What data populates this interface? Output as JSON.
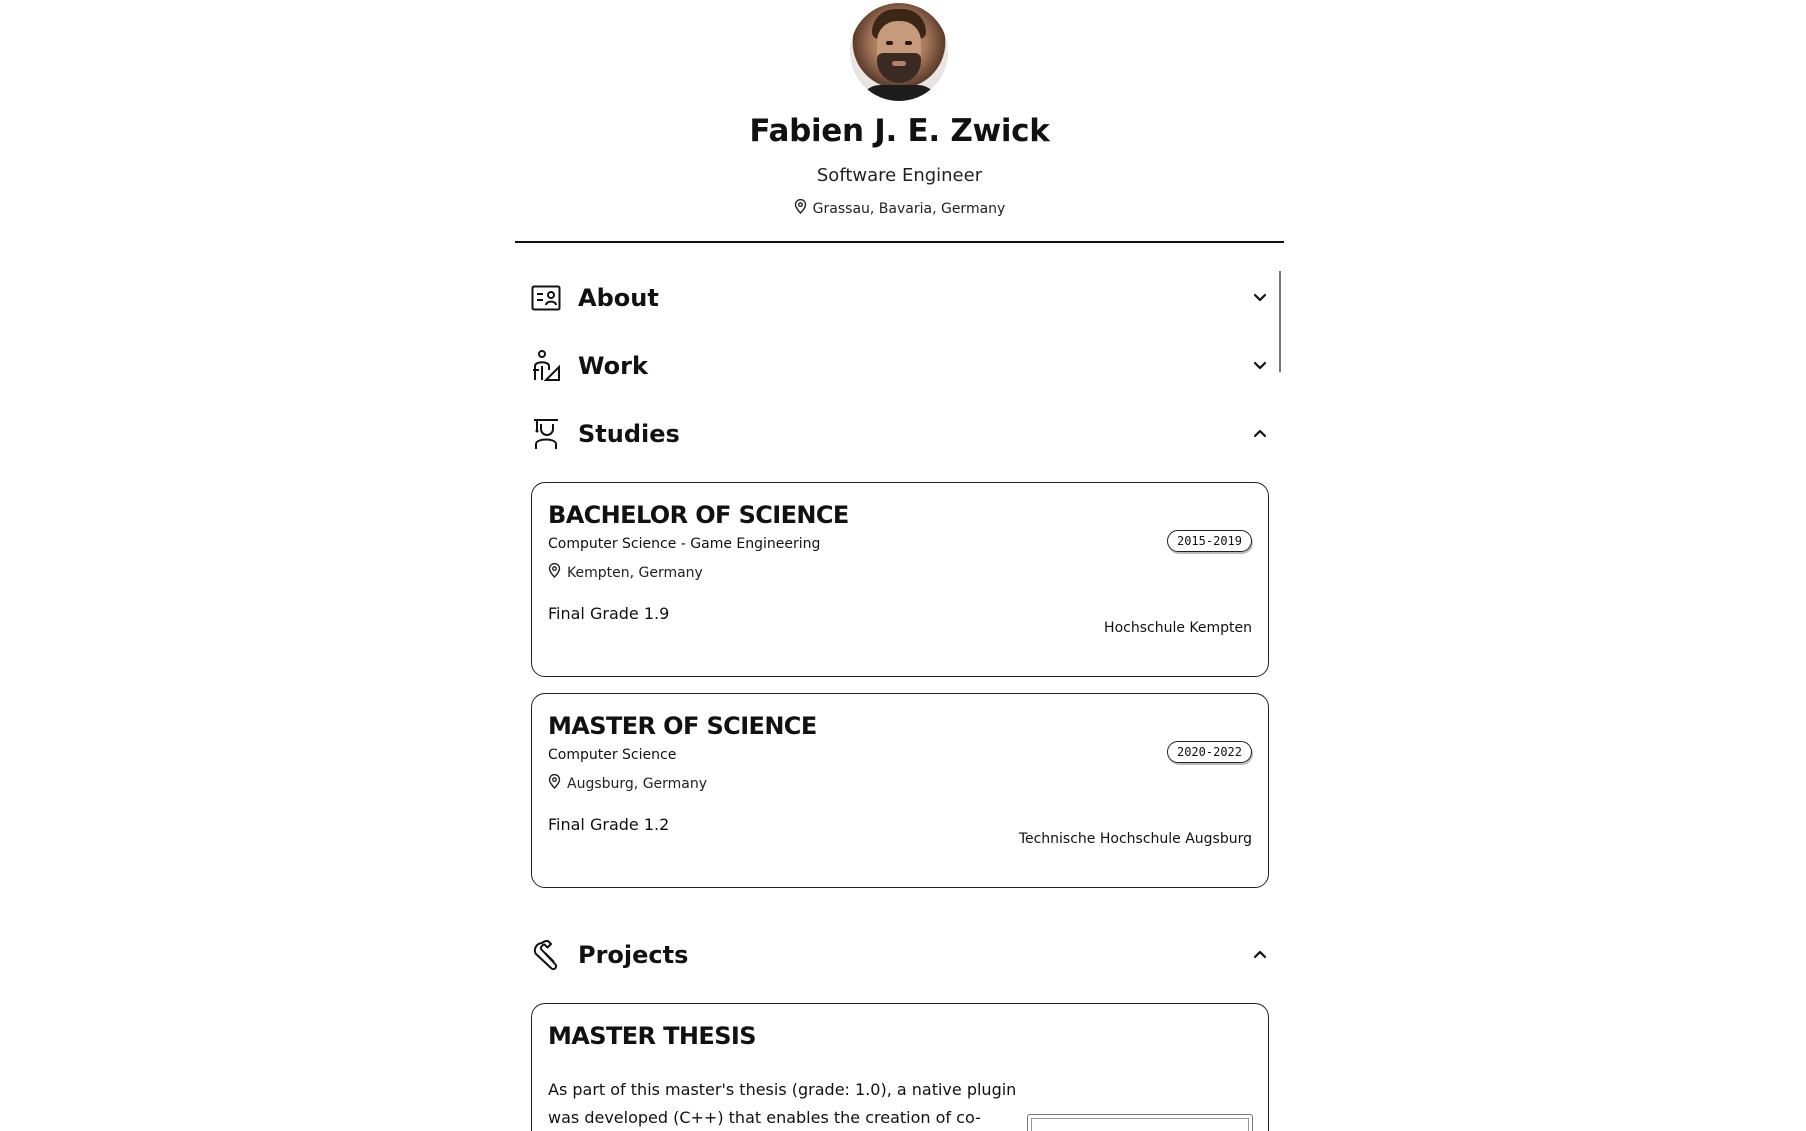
{
  "profile": {
    "name": "Fabien J. E. Zwick",
    "role": "Software Engineer",
    "location": "Grassau, Bavaria, Germany"
  },
  "sections": {
    "about": {
      "label": "About",
      "icon": "id-card-icon",
      "expanded": false
    },
    "work": {
      "label": "Work",
      "icon": "worker-icon",
      "expanded": false
    },
    "studies": {
      "label": "Studies",
      "icon": "graduate-icon",
      "expanded": true
    },
    "projects": {
      "label": "Projects",
      "icon": "wrench-icon",
      "expanded": true
    }
  },
  "studies": [
    {
      "degree": "BACHELOR OF SCIENCE",
      "field": "Computer Science - Game Engineering",
      "location": "Kempten, Germany",
      "years": "2015-2019",
      "grade": "Final Grade 1.9",
      "school": "Hochschule Kempten"
    },
    {
      "degree": "MASTER OF SCIENCE",
      "field": "Computer Science",
      "location": "Augsburg, Germany",
      "years": "2020-2022",
      "grade": "Final Grade 1.2",
      "school": "Technische Hochschule Augsburg"
    }
  ],
  "projects": [
    {
      "title": "MASTER THESIS",
      "text": "As part of this master's thesis (grade: 1.0), a native plugin was developed (C++) that enables the creation of co-located"
    }
  ]
}
